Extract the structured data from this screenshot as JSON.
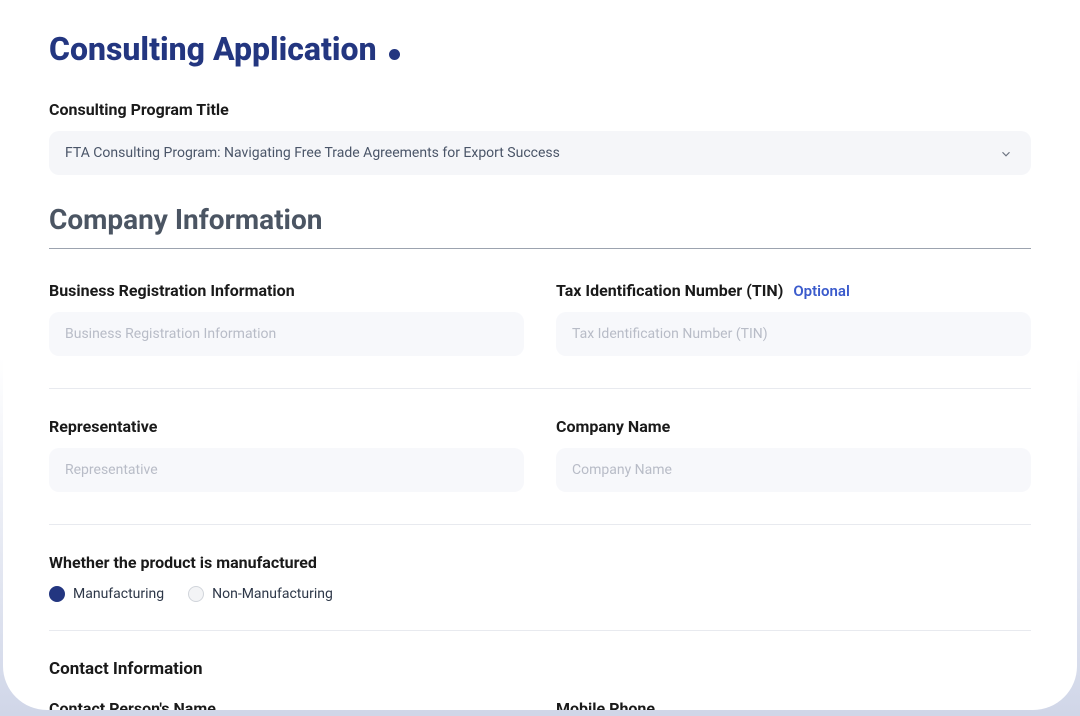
{
  "page": {
    "title": "Consulting Application"
  },
  "program": {
    "label": "Consulting Program Title",
    "selected": "FTA Consulting Program: Navigating Free Trade Agreements for Export Success"
  },
  "company_section": {
    "heading": "Company Information"
  },
  "fields": {
    "business_reg": {
      "label": "Business Registration Information",
      "placeholder": "Business Registration Information"
    },
    "tin": {
      "label": "Tax Identification Number (TIN)",
      "optional": "Optional",
      "placeholder": "Tax Identification Number (TIN)"
    },
    "representative": {
      "label": "Representative",
      "placeholder": "Representative"
    },
    "company_name": {
      "label": "Company Name",
      "placeholder": "Company Name"
    },
    "manufactured": {
      "label": "Whether the product is manufactured",
      "options": {
        "manufacturing": "Manufacturing",
        "non_manufacturing": "Non-Manufacturing"
      },
      "selected": "manufacturing"
    }
  },
  "contact": {
    "heading": "Contact Information",
    "person_label": "Contact Person's Name",
    "mobile_label": "Mobile Phone"
  }
}
